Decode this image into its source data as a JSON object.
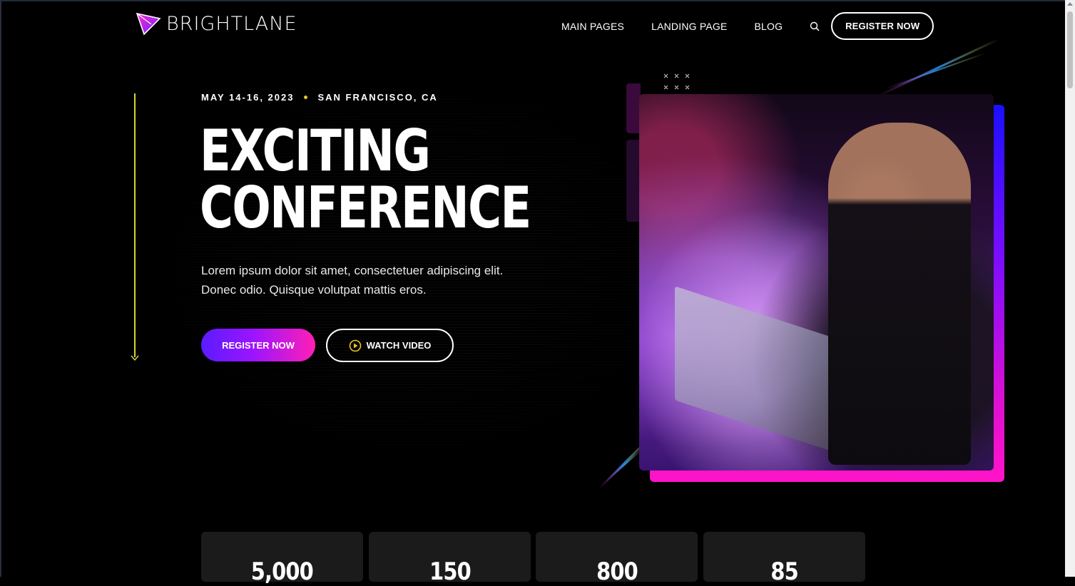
{
  "brand": {
    "name": "BRIGHTLANE",
    "logo_icon": "triangle-logo-icon"
  },
  "nav": {
    "items": [
      "MAIN PAGES",
      "LANDING PAGE",
      "BLOG"
    ],
    "search_icon": "search-icon",
    "cta_label": "REGISTER NOW"
  },
  "hero": {
    "date": "MAY 14-16, 2023",
    "location": "SAN FRANCISCO, CA",
    "headline_line1": "EXCITING",
    "headline_line2": "CONFERENCE",
    "lead_line1": "Lorem ipsum dolor sit amet, consectetuer adipiscing elit.",
    "lead_line2": "Donec odio. Quisque volutpat mattis eros.",
    "primary_cta": "REGISTER NOW",
    "secondary_cta": "WATCH VIDEO",
    "secondary_cta_icon": "play-circle-icon"
  },
  "stats": [
    "5,000",
    "150",
    "800",
    "85"
  ],
  "colors": {
    "background": "#000000",
    "accent_yellow": "#d9d233",
    "gradient_start": "#5a1cff",
    "gradient_end": "#ff1fb5"
  }
}
